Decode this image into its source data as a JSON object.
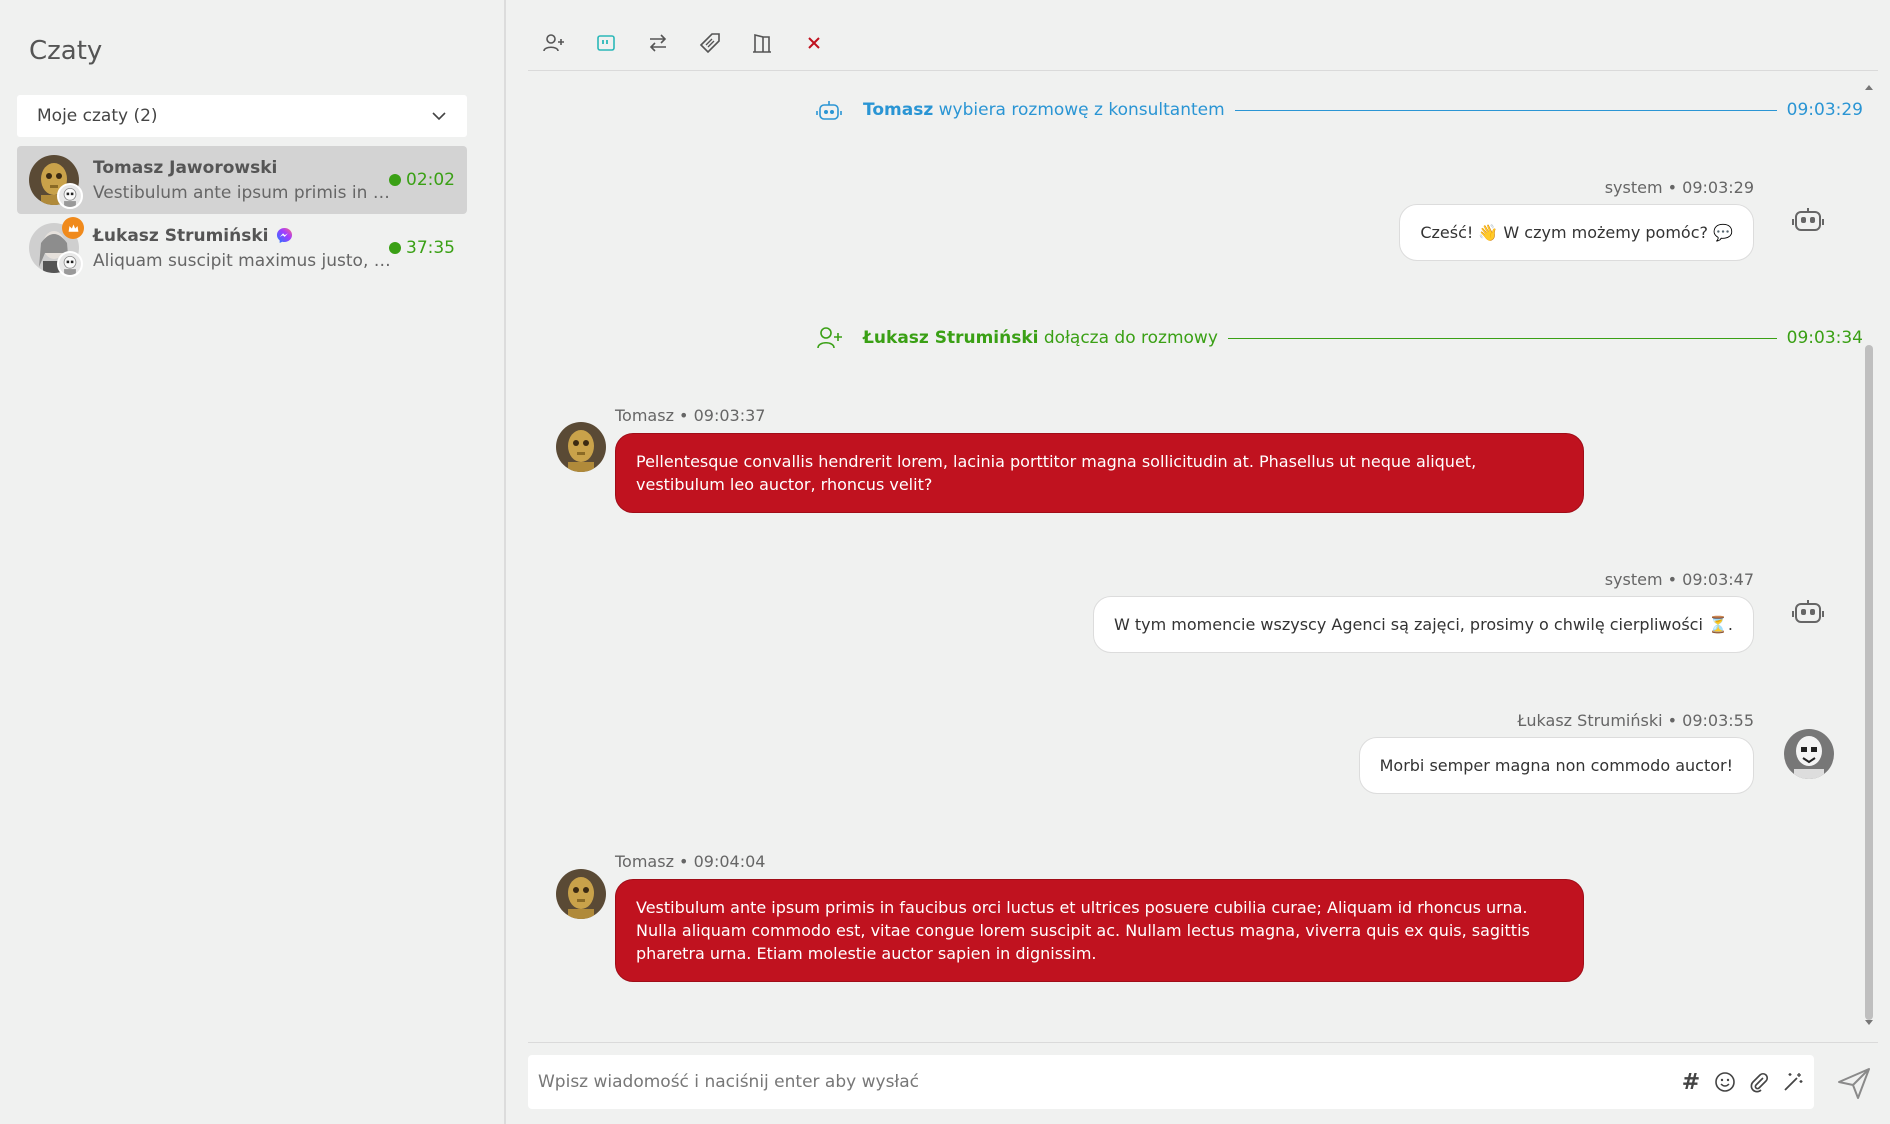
{
  "sidebar": {
    "title": "Czaty",
    "filter": {
      "label": "Moje czaty (2)"
    },
    "chats": [
      {
        "name": "Tomasz Jaworowski",
        "preview": "Vestibulum ante ipsum primis in fauci...",
        "time": "02:02",
        "active": true
      },
      {
        "name": "Łukasz Strumiński",
        "preview": "Aliquam suscipit maximus justo, quis ...",
        "time": "37:35",
        "active": false,
        "channel": "messenger-icon"
      }
    ]
  },
  "toolbar": {
    "tools": [
      "add-user-icon",
      "quote-icon",
      "transfer-icon",
      "tag-icon",
      "leave-icon",
      "close-icon"
    ]
  },
  "messages": {
    "event1": {
      "name": "Tomasz",
      "text": "wybiera rozmowę z konsultantem",
      "time": "09:03:29"
    },
    "m1": {
      "meta": "system • 09:03:29",
      "text": "Cześć! 👋 W czym możemy pomóc? 💬"
    },
    "event2": {
      "name": "Łukasz Strumiński",
      "text": "dołącza do rozmowy",
      "time": "09:03:34"
    },
    "m2": {
      "meta": "Tomasz • 09:03:37",
      "text": "Pellentesque convallis hendrerit lorem, lacinia porttitor magna sollicitudin at. Phasellus ut neque aliquet, vestibulum leo auctor, rhoncus velit?"
    },
    "m3": {
      "meta": "system • 09:03:47",
      "text": "W tym momencie wszyscy Agenci są zajęci, prosimy o chwilę cierpliwości ⏳."
    },
    "m4": {
      "meta": "Łukasz Strumiński • 09:03:55",
      "text": "Morbi semper magna non commodo auctor!"
    },
    "m5": {
      "meta": "Tomasz • 09:04:04",
      "text": "Vestibulum ante ipsum primis in faucibus orci luctus et ultrices posuere cubilia curae; Aliquam id rhoncus urna. Nulla aliquam commodo est, vitae congue lorem suscipit ac. Nullam lectus magna, viverra quis ex quis, sagittis pharetra urna. Etiam molestie auctor sapien in dignissim."
    }
  },
  "composer": {
    "placeholder": "Wpisz wiadomość i naciśnij enter aby wysłać",
    "hash": "#"
  },
  "colors": {
    "accent_red": "#c0121f",
    "event_blue": "#2a95d4",
    "event_green": "#3aa015"
  }
}
